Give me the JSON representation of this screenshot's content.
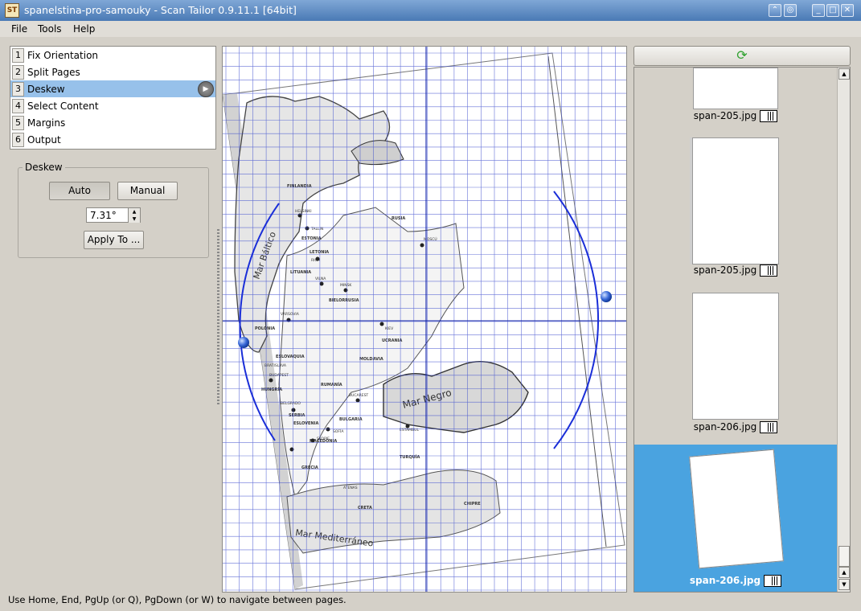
{
  "window": {
    "app_icon_text": "ST",
    "title": "spanelstina-pro-samouky - Scan Tailor 0.9.11.1 [64bit]"
  },
  "menu": [
    "File",
    "Tools",
    "Help"
  ],
  "steps": [
    {
      "num": "1",
      "label": "Fix Orientation"
    },
    {
      "num": "2",
      "label": "Split Pages"
    },
    {
      "num": "3",
      "label": "Deskew",
      "active": true
    },
    {
      "num": "4",
      "label": "Select Content"
    },
    {
      "num": "5",
      "label": "Margins"
    },
    {
      "num": "6",
      "label": "Output"
    }
  ],
  "deskew": {
    "group_title": "Deskew",
    "auto_label": "Auto",
    "manual_label": "Manual",
    "angle_value": "7.31°",
    "apply_label": "Apply To ..."
  },
  "map_labels": {
    "sea_baltic": "Mar Báltico",
    "sea_black": "Mar Negro",
    "sea_med": "Mar Mediterráneo",
    "countries": [
      "FINLANDIA",
      "RUSIA",
      "ESTONIA",
      "LETONIA",
      "LITUANIA",
      "BIELORRUSIA",
      "POLONIA",
      "UCRANIA",
      "ESLOVAQUIA",
      "MOLDAVIA",
      "HUNGRÍA",
      "RUMANÍA",
      "BULGARIA",
      "SERBIA",
      "ESLOVENIA",
      "MACEDONIA",
      "TURQUÍA",
      "GRECIA",
      "CRETA",
      "CHIPRE"
    ],
    "cities": [
      "HELSINKI",
      "TALLIN",
      "RIGA",
      "MOSCÚ",
      "VILNA",
      "MINSK",
      "VARSOVIA",
      "KIEV",
      "BRATISLAVA",
      "BUDAPEST",
      "BUCAREST",
      "BELGRADO",
      "SOFÍA",
      "SKOPJE",
      "ESTAMBUL",
      "ATENAS"
    ]
  },
  "thumbnails": [
    {
      "caption": "span-205.jpg",
      "selected": false
    },
    {
      "caption": "span-205.jpg",
      "selected": false
    },
    {
      "caption": "span-206.jpg",
      "selected": false
    },
    {
      "caption": "span-206.jpg",
      "selected": true
    }
  ],
  "thumb_header": {
    "refresh_icon": "refresh-icon"
  },
  "status": "Use Home, End, PgUp (or Q), PgDown (or W) to navigate between pages.",
  "colors": {
    "selection": "#97c1ea",
    "thumb_selected": "#4aa3e0",
    "grid": "#2233cc",
    "titlebar": "#4a7ab5"
  }
}
